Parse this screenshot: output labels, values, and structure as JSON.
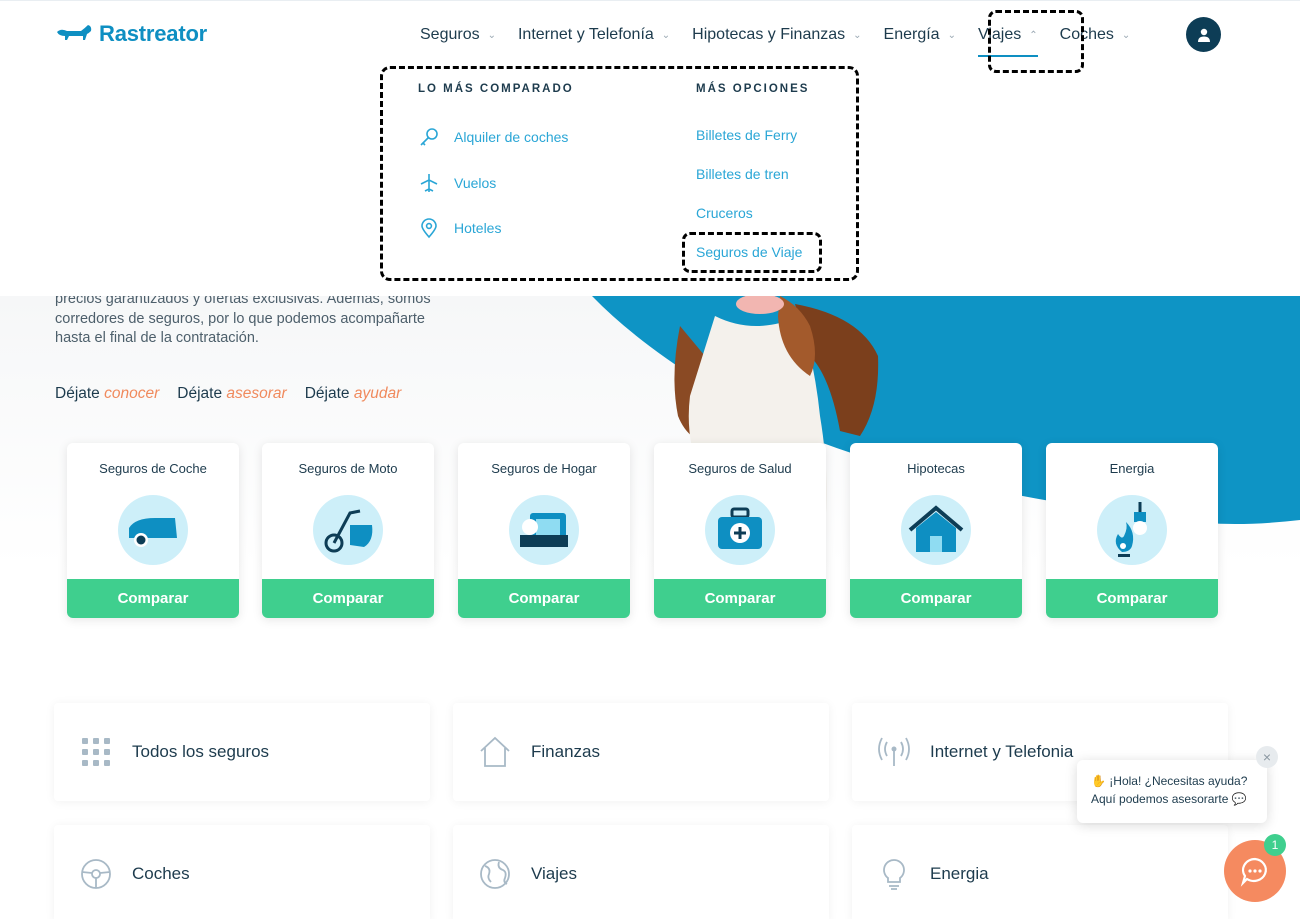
{
  "header": {
    "brand": "Rastreator",
    "nav": [
      {
        "label": "Seguros"
      },
      {
        "label": "Internet y Telefonía"
      },
      {
        "label": "Hipotecas y Finanzas"
      },
      {
        "label": "Energía"
      },
      {
        "label": "Viajes"
      },
      {
        "label": "Coches"
      }
    ]
  },
  "dropdown": {
    "col1_title": "LO MÁS COMPARADO",
    "col2_title": "MÁS OPCIONES",
    "col1": [
      {
        "label": "Alquiler de coches",
        "icon": "key-icon"
      },
      {
        "label": "Vuelos",
        "icon": "plane-icon"
      },
      {
        "label": "Hoteles",
        "icon": "location-pin-icon"
      }
    ],
    "col2": [
      {
        "label": "Billetes de Ferry"
      },
      {
        "label": "Billetes de tren"
      },
      {
        "label": "Cruceros"
      },
      {
        "label": "Seguros de Viaje"
      }
    ]
  },
  "hero": {
    "text_lines": [
      "precios garantizados y ofertas exclusivas. Además, somos",
      "corredores de seguros, por lo que podemos acompañarte",
      "hasta el final de la contratación."
    ],
    "dejate": [
      {
        "prefix": "Déjate",
        "word": "conocer"
      },
      {
        "prefix": "Déjate",
        "word": "asesorar"
      },
      {
        "prefix": "Déjate",
        "word": "ayudar"
      }
    ]
  },
  "products": [
    {
      "title": "Seguros de Coche",
      "button": "Comparar",
      "icon": "car-icon"
    },
    {
      "title": "Seguros de Moto",
      "button": "Comparar",
      "icon": "motorbike-icon"
    },
    {
      "title": "Seguros de Hogar",
      "button": "Comparar",
      "icon": "home-insurance-icon"
    },
    {
      "title": "Seguros de Salud",
      "button": "Comparar",
      "icon": "medical-kit-icon"
    },
    {
      "title": "Hipotecas",
      "button": "Comparar",
      "icon": "house-icon"
    },
    {
      "title": "Energia",
      "button": "Comparar",
      "icon": "energy-icon"
    }
  ],
  "categories": [
    {
      "label": "Todos los seguros",
      "icon": "grid-icon"
    },
    {
      "label": "Finanzas",
      "icon": "house-outline-icon"
    },
    {
      "label": "Internet y Telefonia",
      "icon": "antenna-icon"
    },
    {
      "label": "Coches",
      "icon": "steering-wheel-icon"
    },
    {
      "label": "Viajes",
      "icon": "globe-icon"
    },
    {
      "label": "Energia",
      "icon": "lightbulb-icon"
    }
  ],
  "chat": {
    "line1": "¡Hola! ¿Necesitas ayuda?",
    "line2": "Aquí podemos asesorarte",
    "badge": "1"
  },
  "colors": {
    "brand_blue": "#0e8fc2",
    "link_blue": "#2aa6d6",
    "navy": "#1d3b4d",
    "green": "#3fcf8e",
    "orange": "#f08a5d"
  }
}
